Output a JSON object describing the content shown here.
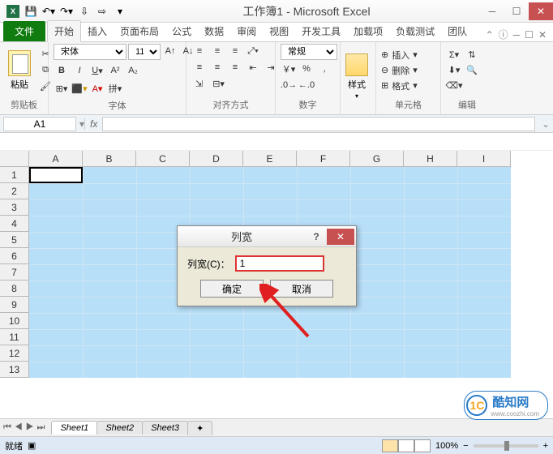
{
  "window": {
    "title": "工作簿1 - Microsoft Excel"
  },
  "qat": {
    "save": "保存",
    "undo": "撤销",
    "redo": "重做"
  },
  "tabs": {
    "file": "文件",
    "list": [
      "开始",
      "插入",
      "页面布局",
      "公式",
      "数据",
      "审阅",
      "视图",
      "开发工具",
      "加载项",
      "负载测试",
      "团队"
    ]
  },
  "ribbon": {
    "clipboard": {
      "paste": "粘贴",
      "label": "剪贴板"
    },
    "font": {
      "name": "宋体",
      "size": "11",
      "label": "字体"
    },
    "align": {
      "label": "对齐方式",
      "wrap": "自动换行",
      "merge": "合并后居中"
    },
    "number": {
      "format": "常规",
      "label": "数字"
    },
    "styles": {
      "btn": "样式",
      "label": ""
    },
    "cells": {
      "insert": "插入",
      "delete": "删除",
      "format": "格式",
      "label": "单元格"
    },
    "editing": {
      "label": "编辑"
    }
  },
  "namebox": {
    "value": "A1"
  },
  "columns": [
    "A",
    "B",
    "C",
    "D",
    "E",
    "F",
    "G",
    "H",
    "I"
  ],
  "rows": [
    "1",
    "2",
    "3",
    "4",
    "5",
    "6",
    "7",
    "8",
    "9",
    "10",
    "11",
    "12",
    "13"
  ],
  "dialog": {
    "title": "列宽",
    "label": "列宽(C)：",
    "value": "1",
    "ok": "确定",
    "cancel": "取消"
  },
  "sheets": {
    "s1": "Sheet1",
    "s2": "Sheet2",
    "s3": "Sheet3"
  },
  "status": {
    "ready": "就绪",
    "zoom": "100%",
    "minus": "−",
    "plus": "+"
  },
  "watermark": {
    "brand": "酷知网",
    "url": "www.coozhi.com",
    "badge": "1C"
  }
}
